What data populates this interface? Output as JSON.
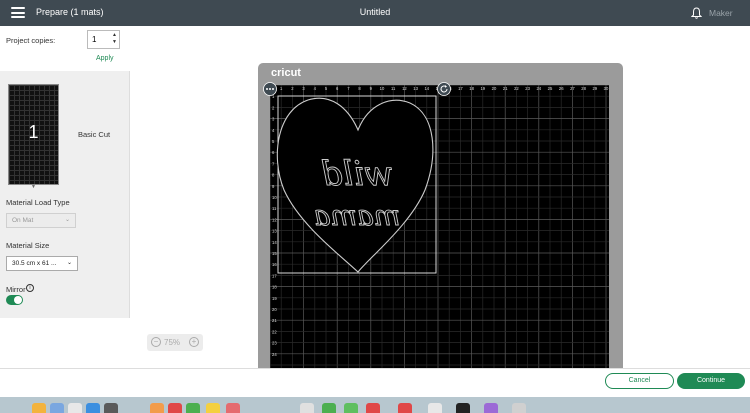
{
  "header": {
    "panel_title": "Prepare (1 mats)",
    "document_title": "Untitled",
    "machine_label": "Maker"
  },
  "left_panel": {
    "project_copies_label": "Project copies:",
    "project_copies_value": "1",
    "apply_label": "Apply",
    "mat_number": "1",
    "mat_label": "Basic Cut",
    "material_load_type_label": "Material Load Type",
    "material_load_type_value": "On Mat",
    "material_size_label": "Material Size",
    "material_size_value": "30.5 cm x 61 ...",
    "mirror_label": "Mirror",
    "mirror_on": true
  },
  "mat": {
    "brand": "cricut",
    "top_ruler": [
      "1",
      "2",
      "3",
      "4",
      "5",
      "6",
      "7",
      "8",
      "9",
      "10",
      "11",
      "12",
      "13",
      "14",
      "15",
      "16",
      "17",
      "18",
      "19",
      "20",
      "21",
      "22",
      "23",
      "24",
      "25",
      "26",
      "27",
      "28",
      "29",
      "30"
    ],
    "left_ruler": [
      "1",
      "2",
      "3",
      "4",
      "5",
      "6",
      "7",
      "8",
      "9",
      "10",
      "11",
      "12",
      "13",
      "14",
      "15",
      "16",
      "17",
      "18",
      "19",
      "20",
      "21",
      "22",
      "23",
      "24"
    ],
    "design_text_line1": "wild",
    "design_text_line2": "mama"
  },
  "canvas": {
    "zoom_label": "75%"
  },
  "footer": {
    "cancel_label": "Cancel",
    "continue_label": "Continue"
  },
  "colors": {
    "accent": "#1f8a55",
    "topbar": "#3f4a52",
    "mat": "#000000"
  }
}
